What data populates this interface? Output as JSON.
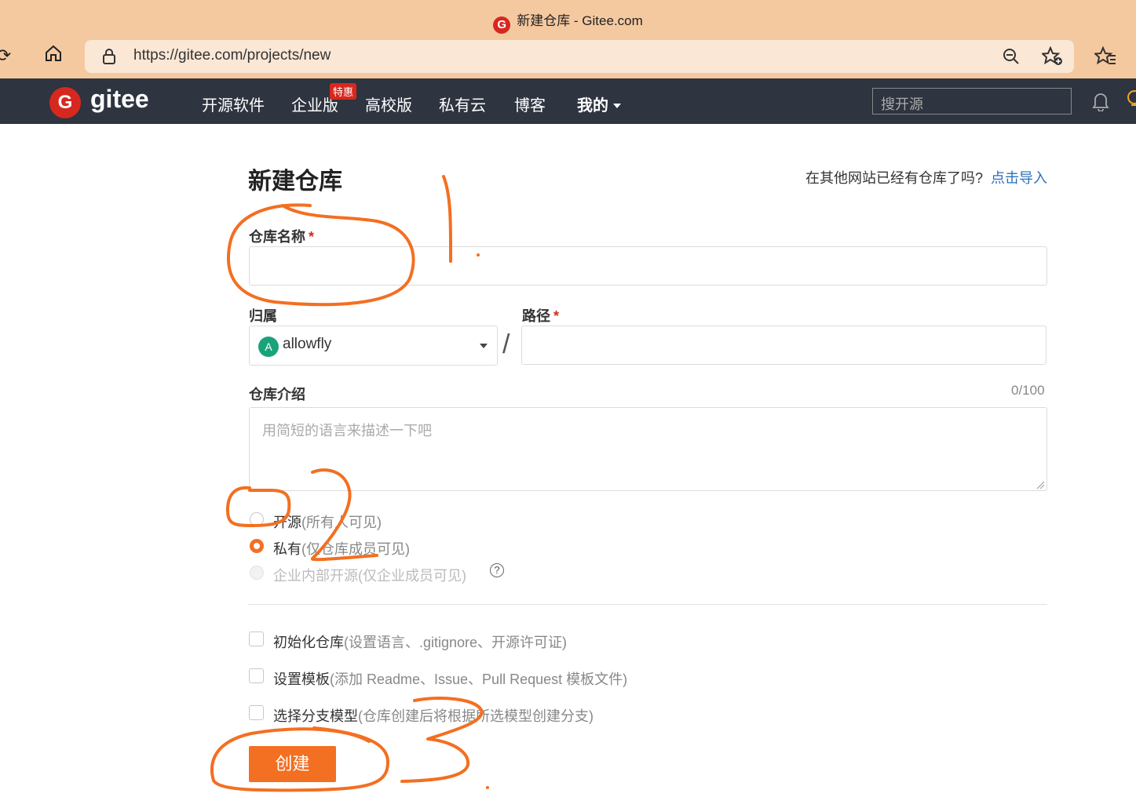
{
  "browser": {
    "tab_title": "新建仓库 - Gitee.com",
    "url": "https://gitee.com/projects/new",
    "tab_icon": "G"
  },
  "nav": {
    "logo_letter": "G",
    "logo_text": "gitee",
    "items": [
      "开源软件",
      "企业版",
      "高校版",
      "私有云",
      "博客",
      "我的"
    ],
    "badge": "特惠",
    "search_placeholder": "搜开源"
  },
  "page": {
    "title": "新建仓库",
    "import_question": "在其他网站已经有仓库了吗?",
    "import_link": "点击导入",
    "repo_name_label": "仓库名称",
    "required_mark": "*",
    "owner_label": "归属",
    "owner_avatar": "A",
    "owner_value": "allowfly",
    "path_label": "路径",
    "slash": "/",
    "desc_label": "仓库介绍",
    "desc_counter": "0/100",
    "desc_placeholder": "用简短的语言来描述一下吧",
    "visibility": [
      {
        "label": "开源",
        "note": "(所有人可见)",
        "selected": false
      },
      {
        "label": "私有",
        "note": "(仅仓库成员可见)",
        "selected": true
      },
      {
        "label": "企业内部开源",
        "note": "(仅企业成员可见)",
        "disabled": true
      }
    ],
    "help_glyph": "?",
    "options": [
      {
        "label": "初始化仓库",
        "note": "(设置语言、.gitignore、开源许可证)"
      },
      {
        "label": "设置模板",
        "note": "(添加 Readme、Issue、Pull Request 模板文件)"
      },
      {
        "label": "选择分支模型",
        "note": "(仓库创建后将根据所选模型创建分支)"
      }
    ],
    "create_button": "创建"
  },
  "colors": {
    "chrome_bg": "#f5c9a0",
    "nav_bg": "#2e3440",
    "brand_red": "#d7281f",
    "accent_orange": "#f36f21",
    "link_blue": "#2d6fb8",
    "annotation": "#f36f21"
  }
}
